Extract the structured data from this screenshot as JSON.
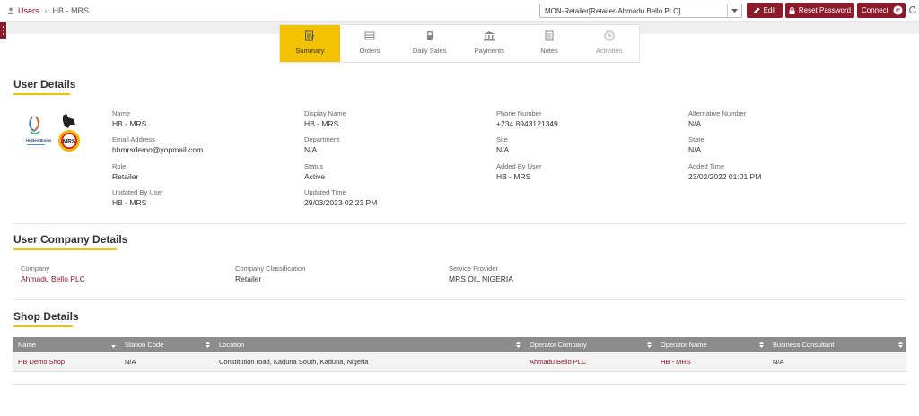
{
  "breadcrumb": {
    "root": "Users",
    "current": "HB - MRS"
  },
  "header": {
    "selector_value": "MON-Retailer[Retailer-Ahmadu Bello PLC]",
    "edit_label": "Edit",
    "reset_password_label": "Reset Password",
    "connect_label": "Connect"
  },
  "tabs": [
    {
      "label": "Summary",
      "icon": "summary-icon",
      "active": true
    },
    {
      "label": "Orders",
      "icon": "orders-icon"
    },
    {
      "label": "Daily Sales",
      "icon": "daily-sales-icon"
    },
    {
      "label": "Payments",
      "icon": "payments-icon"
    },
    {
      "label": "Notes",
      "icon": "notes-icon"
    },
    {
      "label": "Activities",
      "icon": "activities-icon",
      "disabled": true
    }
  ],
  "user_details": {
    "title": "User Details",
    "logo_text": {
      "hidden_brains": "Hidden Brains",
      "mrs": "MRS"
    },
    "fields": {
      "name": {
        "label": "Name",
        "value": "HB - MRS"
      },
      "display_name": {
        "label": "Display Name",
        "value": "HB - MRS"
      },
      "phone": {
        "label": "Phone Number",
        "value": "+234 8943121349"
      },
      "alt_number": {
        "label": "Alternative Number",
        "value": "N/A"
      },
      "email": {
        "label": "Email Address",
        "value": "hbmrsdemo@yopmail.com"
      },
      "department": {
        "label": "Department",
        "value": "N/A"
      },
      "site": {
        "label": "Site",
        "value": "N/A"
      },
      "state": {
        "label": "State",
        "value": "N/A"
      },
      "role": {
        "label": "Role",
        "value": "Retailer"
      },
      "status": {
        "label": "Status",
        "value": "Active"
      },
      "added_by": {
        "label": "Added By User",
        "value": "HB - MRS"
      },
      "added_time": {
        "label": "Added Time",
        "value": "23/02/2022 01:01 PM"
      },
      "updated_by": {
        "label": "Updated By User",
        "value": "HB - MRS"
      },
      "updated_time": {
        "label": "Updated Time",
        "value": "29/03/2023 02:23 PM"
      }
    }
  },
  "company_details": {
    "title": "User Company Details",
    "company": {
      "label": "Company",
      "value": "Ahmadu Bello PLC"
    },
    "classification": {
      "label": "Company Classification",
      "value": "Retailer"
    },
    "provider": {
      "label": "Service Provider",
      "value": "MRS OIL NIGERIA"
    }
  },
  "shop_details": {
    "title": "Shop Details",
    "columns": [
      "Name",
      "Station Code",
      "Location",
      "Operator Company",
      "Operator Name",
      "Business Consultant"
    ],
    "rows": [
      [
        "HB Demo Shop",
        "N/A",
        "Constitution road, Kaduna South, Kaduna, Nigeria",
        "Ahmadu Bello PLC",
        "HB - MRS",
        "N/A"
      ]
    ]
  },
  "colors": {
    "brand": "#8b1a2b",
    "accent": "#f2c200",
    "table_header": "#8c8c8c"
  }
}
